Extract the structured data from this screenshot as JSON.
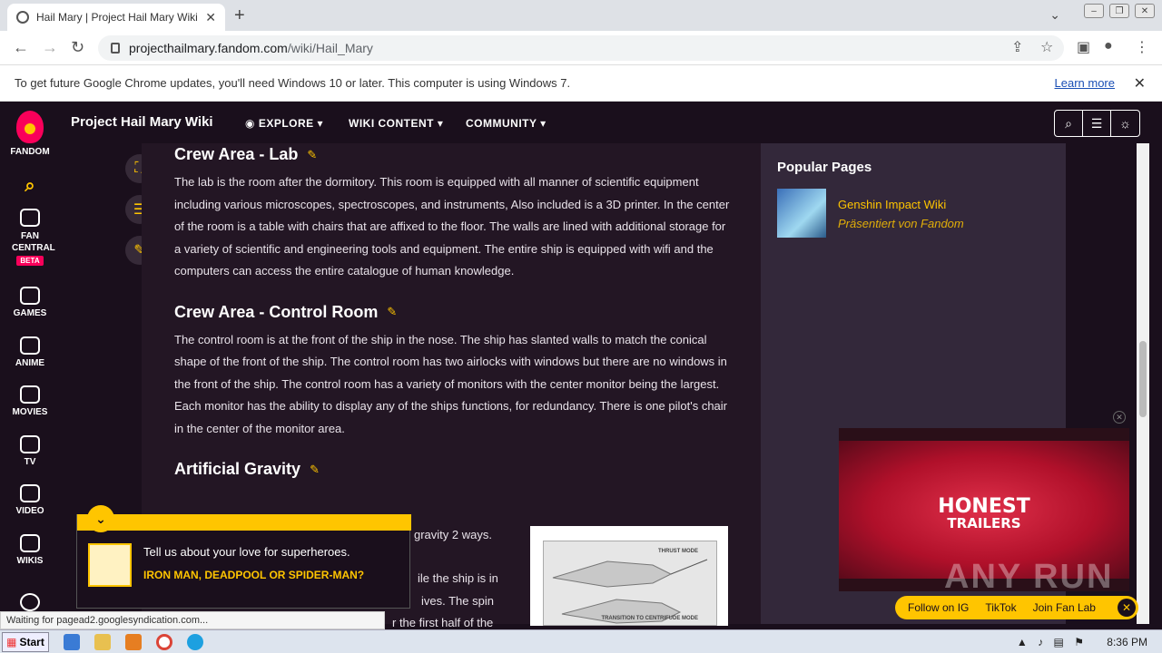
{
  "browser": {
    "tab_title": "Hail Mary | Project Hail Mary Wiki | F",
    "url_domain": "projecthailmary.fandom.com",
    "url_path": "/wiki/Hail_Mary",
    "infobar_text": "To get future Google Chrome updates, you'll need Windows 10 or later. This computer is using Windows 7.",
    "infobar_link": "Learn more",
    "status_text": "Waiting for pagead2.googlesyndication.com..."
  },
  "global_nav": {
    "brand": "FANDOM",
    "items": [
      {
        "label": "FAN CENTRAL",
        "badge": "BETA"
      },
      {
        "label": "GAMES"
      },
      {
        "label": "ANIME"
      },
      {
        "label": "MOVIES"
      },
      {
        "label": "TV"
      },
      {
        "label": "VIDEO"
      },
      {
        "label": "WIKIS"
      }
    ]
  },
  "wiki_header": {
    "title": "Project Hail Mary Wiki",
    "menus": [
      "EXPLORE",
      "WIKI CONTENT",
      "COMMUNITY"
    ]
  },
  "article": {
    "sections": [
      {
        "heading": "Crew Area - Lab",
        "text": "The lab is the room after the dormitory. This room is equipped with all manner of scientific equipment including various microscopes, spectroscopes, and instruments, Also included is a 3D printer. In the center of the room is a table with chairs that are affixed to the floor. The walls are lined with additional storage for a variety of scientific and engineering tools and equipment. The entire ship is equipped with wifi and the computers can access the entire catalogue of human knowledge."
      },
      {
        "heading": "Crew Area - Control Room",
        "text": "The control room is at the front of the ship in the nose. The ship has slanted walls to match the conical shape of the front of the ship. The control room has two airlocks with windows but there are no windows in the front of the ship. The control room has a variety of monitors with the center monitor being the largest. Each monitor has the ability to display any of the ships functions, for redundancy. There is one pilot's chair in the center of the monitor area."
      },
      {
        "heading": "Artificial Gravity",
        "fragments": [
          "gravity 2 ways.",
          "ile the ship is in",
          "ives. The spin",
          "r the first half of the"
        ]
      }
    ],
    "figure_labels": [
      "THRUST MODE",
      "TRANSITION TO CENTRIFUDE MODE"
    ]
  },
  "sidebar": {
    "heading": "Popular Pages",
    "items": [
      {
        "title": "Genshin Impact Wiki",
        "subtitle": "Präsentiert von Fandom"
      }
    ]
  },
  "video_ad": {
    "logo_line1": "HONEST",
    "logo_line2": "TRAILERS",
    "social": [
      "Follow on IG",
      "TikTok",
      "Join Fan Lab"
    ]
  },
  "watermark": "ANY RUN",
  "quiz": {
    "question": "Tell us about your love for superheroes.",
    "answer": "IRON MAN, DEADPOOL OR SPIDER-MAN?"
  },
  "taskbar": {
    "start": "Start",
    "time": "8:36 PM"
  }
}
